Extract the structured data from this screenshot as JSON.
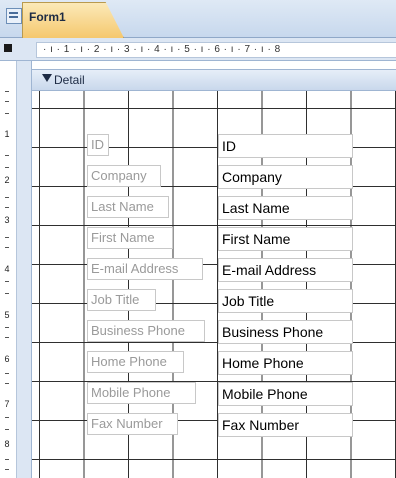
{
  "window": {
    "tab_title": "Form1"
  },
  "ruler": {
    "horizontal_text": "· ı · 1 · ı · 2 · ı · 3 · ı · 4 · ı · 5 · ı · 6 · ı · 7 · ı · 8",
    "vertical_marks": [
      "1",
      "2",
      "3",
      "4",
      "5",
      "6",
      "7",
      "8"
    ]
  },
  "section": {
    "label": "Detail"
  },
  "fields": [
    {
      "label": "ID",
      "value": "ID"
    },
    {
      "label": "Company",
      "value": "Company"
    },
    {
      "label": "Last Name",
      "value": "Last Name"
    },
    {
      "label": "First Name",
      "value": "First Name"
    },
    {
      "label": "E-mail Address",
      "value": "E-mail Address"
    },
    {
      "label": "Job Title",
      "value": "Job Title"
    },
    {
      "label": "Business Phone",
      "value": "Business Phone"
    },
    {
      "label": "Home Phone",
      "value": "Home Phone"
    },
    {
      "label": "Mobile Phone",
      "value": "Mobile Phone"
    },
    {
      "label": "Fax Number",
      "value": "Fax Number"
    }
  ]
}
